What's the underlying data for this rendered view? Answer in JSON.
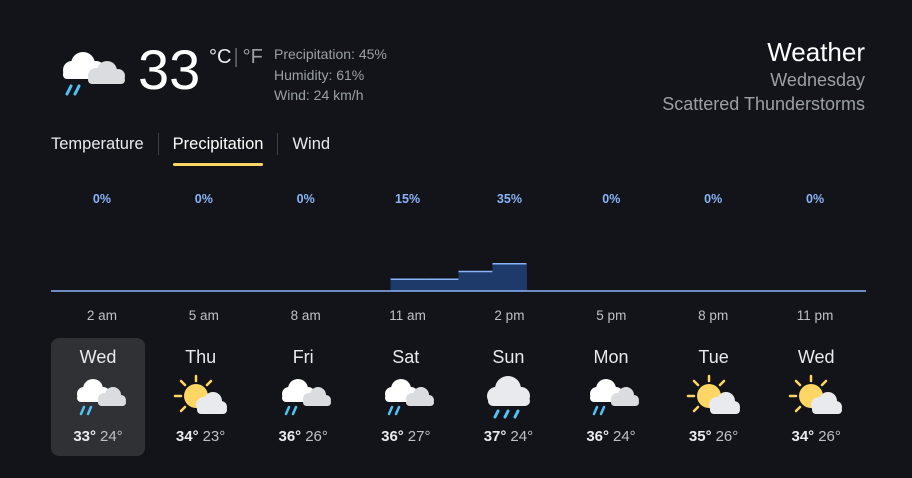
{
  "current": {
    "temp": "33",
    "unit_c": "°C",
    "unit_f": "°F",
    "precipitation": "Precipitation: 45%",
    "humidity": "Humidity: 61%",
    "wind": "Wind: 24 km/h",
    "icon": "thunderstorm-rain-icon"
  },
  "header": {
    "title": "Weather",
    "day": "Wednesday",
    "condition": "Scattered Thunderstorms"
  },
  "tabs": [
    {
      "label": "Temperature",
      "active": false
    },
    {
      "label": "Precipitation",
      "active": true
    },
    {
      "label": "Wind",
      "active": false
    }
  ],
  "chart_data": {
    "type": "area",
    "x": [
      "2 am",
      "5 am",
      "8 am",
      "11 am",
      "2 pm",
      "5 pm",
      "8 pm",
      "11 pm"
    ],
    "value_labels": [
      "0%",
      "0%",
      "0%",
      "15%",
      "35%",
      "0%",
      "0%",
      "0%"
    ],
    "series": [
      {
        "values_pct": [
          0,
          0,
          0,
          0,
          0,
          0,
          0,
          0,
          0,
          0,
          15,
          15,
          25,
          35,
          0,
          0,
          0,
          0,
          0,
          0,
          0,
          0,
          0,
          0
        ]
      }
    ],
    "ylim": [
      0,
      100
    ],
    "colors": {
      "fill": "#1e3a6b",
      "line": "#8ab4f8",
      "label": "#8ab4f8",
      "tick": "#bdc1c6"
    }
  },
  "days": [
    {
      "name": "Wed",
      "hi": "33°",
      "lo": "24°",
      "icon": "thunderstorm-rain-icon",
      "selected": true
    },
    {
      "name": "Thu",
      "hi": "34°",
      "lo": "23°",
      "icon": "partly-cloudy-icon",
      "selected": false
    },
    {
      "name": "Fri",
      "hi": "36°",
      "lo": "26°",
      "icon": "thunderstorm-rain-icon",
      "selected": false
    },
    {
      "name": "Sat",
      "hi": "36°",
      "lo": "27°",
      "icon": "thunderstorm-rain-icon",
      "selected": false
    },
    {
      "name": "Sun",
      "hi": "37°",
      "lo": "24°",
      "icon": "rain-icon",
      "selected": false
    },
    {
      "name": "Mon",
      "hi": "36°",
      "lo": "24°",
      "icon": "thunderstorm-rain-icon",
      "selected": false
    },
    {
      "name": "Tue",
      "hi": "35°",
      "lo": "26°",
      "icon": "partly-cloudy-icon",
      "selected": false
    },
    {
      "name": "Wed",
      "hi": "34°",
      "lo": "26°",
      "icon": "partly-cloudy-icon",
      "selected": false
    }
  ]
}
